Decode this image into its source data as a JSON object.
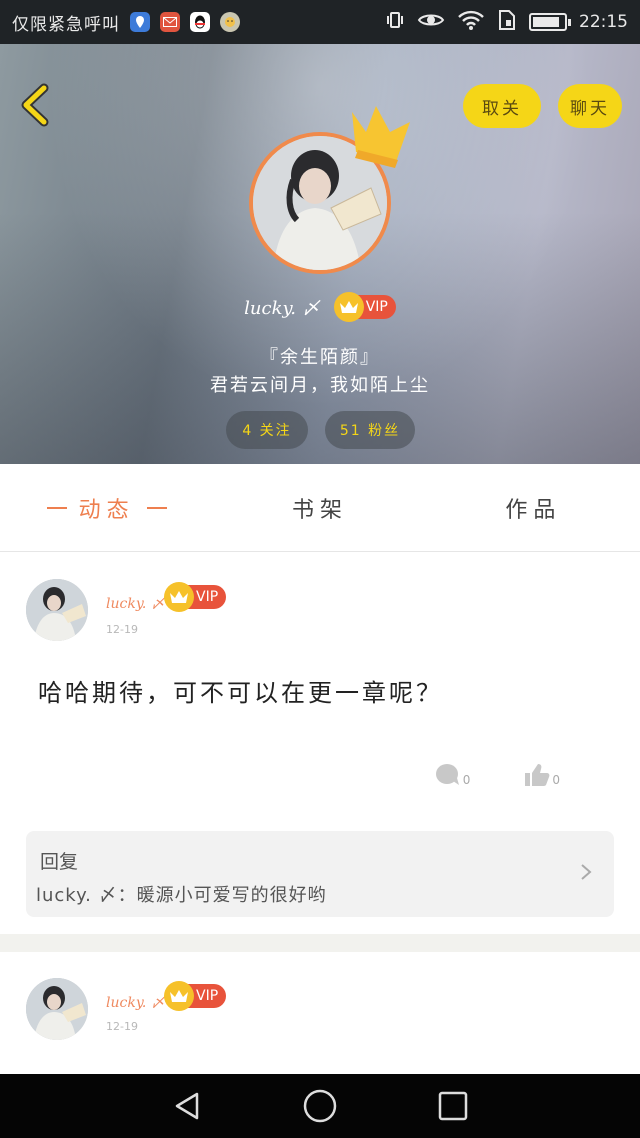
{
  "status_bar": {
    "carrier": "仅限紧急呼叫",
    "time": "22:15",
    "apps": [
      "map-app-icon",
      "mail-app-icon",
      "qq-app-icon",
      "emoji-app-icon"
    ],
    "battery_level": 0.85
  },
  "header": {
    "follow_button": "取关",
    "chat_button": "聊天",
    "username": "lucky. 〆",
    "vip_label": "VIP",
    "signature_line1": "『余生陌颜』",
    "signature_line2": "君若云间月，我如陌上尘",
    "following_label": "4 关注",
    "fans_label": "51 粉丝"
  },
  "tabs": [
    {
      "label": "动态",
      "active": true
    },
    {
      "label": "书架",
      "active": false
    },
    {
      "label": "作品",
      "active": false
    }
  ],
  "posts": [
    {
      "username": "lucky. 〆",
      "vip": "VIP",
      "date": "12-19",
      "content": "哈哈期待，可不可以在更一章呢？",
      "comment_count": "0",
      "like_count": "0",
      "reply_title": "回复",
      "reply_text": "lucky. 〆：暖源小可爱写的很好哟"
    },
    {
      "username": "lucky. 〆",
      "vip": "VIP",
      "date": "12-19"
    }
  ],
  "colors": {
    "accent_orange": "#ee7f4f",
    "button_yellow": "#f5d617",
    "vip_red": "#e8533b",
    "crown_gold": "#f6c12a"
  }
}
